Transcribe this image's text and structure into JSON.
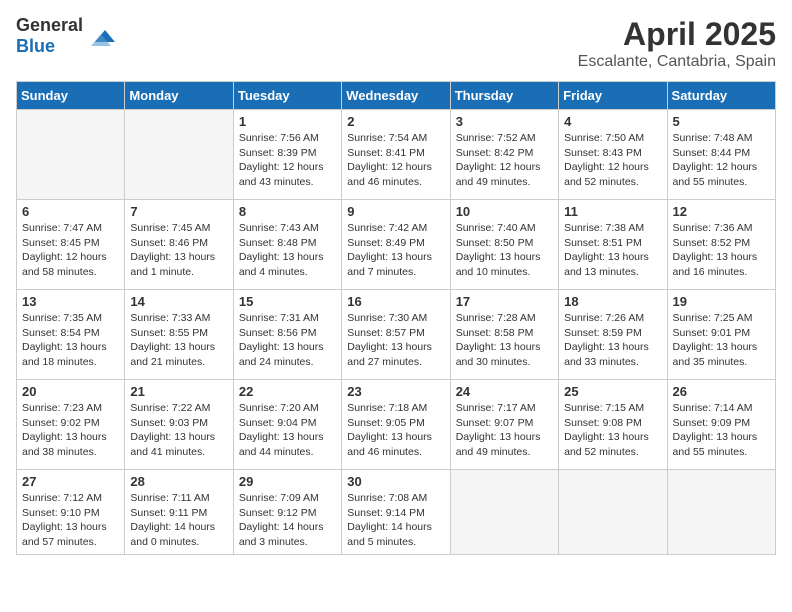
{
  "header": {
    "logo_general": "General",
    "logo_blue": "Blue",
    "title": "April 2025",
    "subtitle": "Escalante, Cantabria, Spain"
  },
  "days_of_week": [
    "Sunday",
    "Monday",
    "Tuesday",
    "Wednesday",
    "Thursday",
    "Friday",
    "Saturday"
  ],
  "weeks": [
    [
      {
        "day": null,
        "info": null
      },
      {
        "day": null,
        "info": null
      },
      {
        "day": "1",
        "sunrise": "Sunrise: 7:56 AM",
        "sunset": "Sunset: 8:39 PM",
        "daylight": "Daylight: 12 hours and 43 minutes."
      },
      {
        "day": "2",
        "sunrise": "Sunrise: 7:54 AM",
        "sunset": "Sunset: 8:41 PM",
        "daylight": "Daylight: 12 hours and 46 minutes."
      },
      {
        "day": "3",
        "sunrise": "Sunrise: 7:52 AM",
        "sunset": "Sunset: 8:42 PM",
        "daylight": "Daylight: 12 hours and 49 minutes."
      },
      {
        "day": "4",
        "sunrise": "Sunrise: 7:50 AM",
        "sunset": "Sunset: 8:43 PM",
        "daylight": "Daylight: 12 hours and 52 minutes."
      },
      {
        "day": "5",
        "sunrise": "Sunrise: 7:48 AM",
        "sunset": "Sunset: 8:44 PM",
        "daylight": "Daylight: 12 hours and 55 minutes."
      }
    ],
    [
      {
        "day": "6",
        "sunrise": "Sunrise: 7:47 AM",
        "sunset": "Sunset: 8:45 PM",
        "daylight": "Daylight: 12 hours and 58 minutes."
      },
      {
        "day": "7",
        "sunrise": "Sunrise: 7:45 AM",
        "sunset": "Sunset: 8:46 PM",
        "daylight": "Daylight: 13 hours and 1 minute."
      },
      {
        "day": "8",
        "sunrise": "Sunrise: 7:43 AM",
        "sunset": "Sunset: 8:48 PM",
        "daylight": "Daylight: 13 hours and 4 minutes."
      },
      {
        "day": "9",
        "sunrise": "Sunrise: 7:42 AM",
        "sunset": "Sunset: 8:49 PM",
        "daylight": "Daylight: 13 hours and 7 minutes."
      },
      {
        "day": "10",
        "sunrise": "Sunrise: 7:40 AM",
        "sunset": "Sunset: 8:50 PM",
        "daylight": "Daylight: 13 hours and 10 minutes."
      },
      {
        "day": "11",
        "sunrise": "Sunrise: 7:38 AM",
        "sunset": "Sunset: 8:51 PM",
        "daylight": "Daylight: 13 hours and 13 minutes."
      },
      {
        "day": "12",
        "sunrise": "Sunrise: 7:36 AM",
        "sunset": "Sunset: 8:52 PM",
        "daylight": "Daylight: 13 hours and 16 minutes."
      }
    ],
    [
      {
        "day": "13",
        "sunrise": "Sunrise: 7:35 AM",
        "sunset": "Sunset: 8:54 PM",
        "daylight": "Daylight: 13 hours and 18 minutes."
      },
      {
        "day": "14",
        "sunrise": "Sunrise: 7:33 AM",
        "sunset": "Sunset: 8:55 PM",
        "daylight": "Daylight: 13 hours and 21 minutes."
      },
      {
        "day": "15",
        "sunrise": "Sunrise: 7:31 AM",
        "sunset": "Sunset: 8:56 PM",
        "daylight": "Daylight: 13 hours and 24 minutes."
      },
      {
        "day": "16",
        "sunrise": "Sunrise: 7:30 AM",
        "sunset": "Sunset: 8:57 PM",
        "daylight": "Daylight: 13 hours and 27 minutes."
      },
      {
        "day": "17",
        "sunrise": "Sunrise: 7:28 AM",
        "sunset": "Sunset: 8:58 PM",
        "daylight": "Daylight: 13 hours and 30 minutes."
      },
      {
        "day": "18",
        "sunrise": "Sunrise: 7:26 AM",
        "sunset": "Sunset: 8:59 PM",
        "daylight": "Daylight: 13 hours and 33 minutes."
      },
      {
        "day": "19",
        "sunrise": "Sunrise: 7:25 AM",
        "sunset": "Sunset: 9:01 PM",
        "daylight": "Daylight: 13 hours and 35 minutes."
      }
    ],
    [
      {
        "day": "20",
        "sunrise": "Sunrise: 7:23 AM",
        "sunset": "Sunset: 9:02 PM",
        "daylight": "Daylight: 13 hours and 38 minutes."
      },
      {
        "day": "21",
        "sunrise": "Sunrise: 7:22 AM",
        "sunset": "Sunset: 9:03 PM",
        "daylight": "Daylight: 13 hours and 41 minutes."
      },
      {
        "day": "22",
        "sunrise": "Sunrise: 7:20 AM",
        "sunset": "Sunset: 9:04 PM",
        "daylight": "Daylight: 13 hours and 44 minutes."
      },
      {
        "day": "23",
        "sunrise": "Sunrise: 7:18 AM",
        "sunset": "Sunset: 9:05 PM",
        "daylight": "Daylight: 13 hours and 46 minutes."
      },
      {
        "day": "24",
        "sunrise": "Sunrise: 7:17 AM",
        "sunset": "Sunset: 9:07 PM",
        "daylight": "Daylight: 13 hours and 49 minutes."
      },
      {
        "day": "25",
        "sunrise": "Sunrise: 7:15 AM",
        "sunset": "Sunset: 9:08 PM",
        "daylight": "Daylight: 13 hours and 52 minutes."
      },
      {
        "day": "26",
        "sunrise": "Sunrise: 7:14 AM",
        "sunset": "Sunset: 9:09 PM",
        "daylight": "Daylight: 13 hours and 55 minutes."
      }
    ],
    [
      {
        "day": "27",
        "sunrise": "Sunrise: 7:12 AM",
        "sunset": "Sunset: 9:10 PM",
        "daylight": "Daylight: 13 hours and 57 minutes."
      },
      {
        "day": "28",
        "sunrise": "Sunrise: 7:11 AM",
        "sunset": "Sunset: 9:11 PM",
        "daylight": "Daylight: 14 hours and 0 minutes."
      },
      {
        "day": "29",
        "sunrise": "Sunrise: 7:09 AM",
        "sunset": "Sunset: 9:12 PM",
        "daylight": "Daylight: 14 hours and 3 minutes."
      },
      {
        "day": "30",
        "sunrise": "Sunrise: 7:08 AM",
        "sunset": "Sunset: 9:14 PM",
        "daylight": "Daylight: 14 hours and 5 minutes."
      },
      {
        "day": null,
        "info": null
      },
      {
        "day": null,
        "info": null
      },
      {
        "day": null,
        "info": null
      }
    ]
  ]
}
